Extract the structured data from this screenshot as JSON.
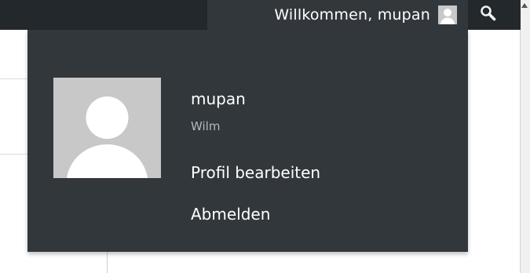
{
  "admin_bar": {
    "welcome_text": "Willkommen, mupan",
    "avatar_icon": "user-avatar-icon",
    "search_icon": "search-icon"
  },
  "account_menu": {
    "display_name": "mupan",
    "username": "Wilm",
    "edit_profile_label": "Profil bearbeiten",
    "logout_label": "Abmelden"
  },
  "colors": {
    "admin_bar_bg": "#23282d",
    "menu_bg": "#32373c",
    "text": "#ffffff",
    "muted_text": "#b4b9be",
    "avatar_bg": "#c8c8c8"
  }
}
